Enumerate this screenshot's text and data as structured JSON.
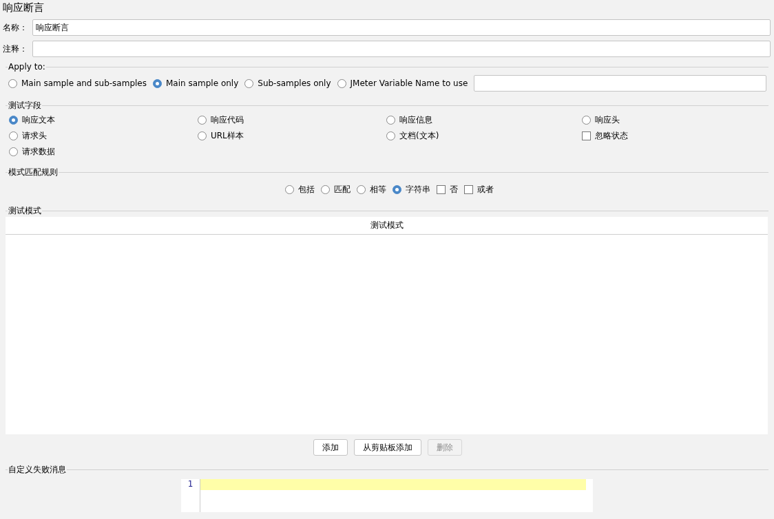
{
  "title": "响应断言",
  "name_field": {
    "label": "名称：",
    "value": "响应断言"
  },
  "comment_field": {
    "label": "注释："
  },
  "apply_to": {
    "legend": "Apply to:",
    "options": [
      {
        "label": "Main sample and sub-samples",
        "selected": false
      },
      {
        "label": "Main sample only",
        "selected": true
      },
      {
        "label": "Sub-samples only",
        "selected": false
      },
      {
        "label": "JMeter Variable Name to use",
        "selected": false
      }
    ]
  },
  "test_field": {
    "legend": "测试字段",
    "options": [
      {
        "label": "响应文本",
        "kind": "radio",
        "selected": true
      },
      {
        "label": "响应代码",
        "kind": "radio",
        "selected": false
      },
      {
        "label": "响应信息",
        "kind": "radio",
        "selected": false
      },
      {
        "label": "响应头",
        "kind": "radio",
        "selected": false
      },
      {
        "label": "请求头",
        "kind": "radio",
        "selected": false
      },
      {
        "label": "URL样本",
        "kind": "radio",
        "selected": false
      },
      {
        "label": "文档(文本)",
        "kind": "radio",
        "selected": false
      },
      {
        "label": "忽略状态",
        "kind": "checkbox",
        "checked": false
      },
      {
        "label": "请求数据",
        "kind": "radio",
        "selected": false
      }
    ]
  },
  "pattern_rules": {
    "legend": "模式匹配规则",
    "options": [
      {
        "label": "包括",
        "kind": "radio",
        "selected": false
      },
      {
        "label": "匹配",
        "kind": "radio",
        "selected": false
      },
      {
        "label": "相等",
        "kind": "radio",
        "selected": false
      },
      {
        "label": "字符串",
        "kind": "radio",
        "selected": true
      },
      {
        "label": "否",
        "kind": "checkbox",
        "checked": false
      },
      {
        "label": "或者",
        "kind": "checkbox",
        "checked": false
      }
    ]
  },
  "test_patterns": {
    "legend": "测试模式",
    "table": {
      "columns": [
        "测试模式"
      ]
    },
    "buttons": [
      {
        "label": "添加",
        "disabled": false
      },
      {
        "label": "从剪贴板添加",
        "disabled": false
      },
      {
        "label": "删除",
        "disabled": true
      }
    ]
  },
  "custom_message": {
    "legend": "自定义失败消息",
    "editor": {
      "line_numbers": [
        "1"
      ]
    }
  }
}
